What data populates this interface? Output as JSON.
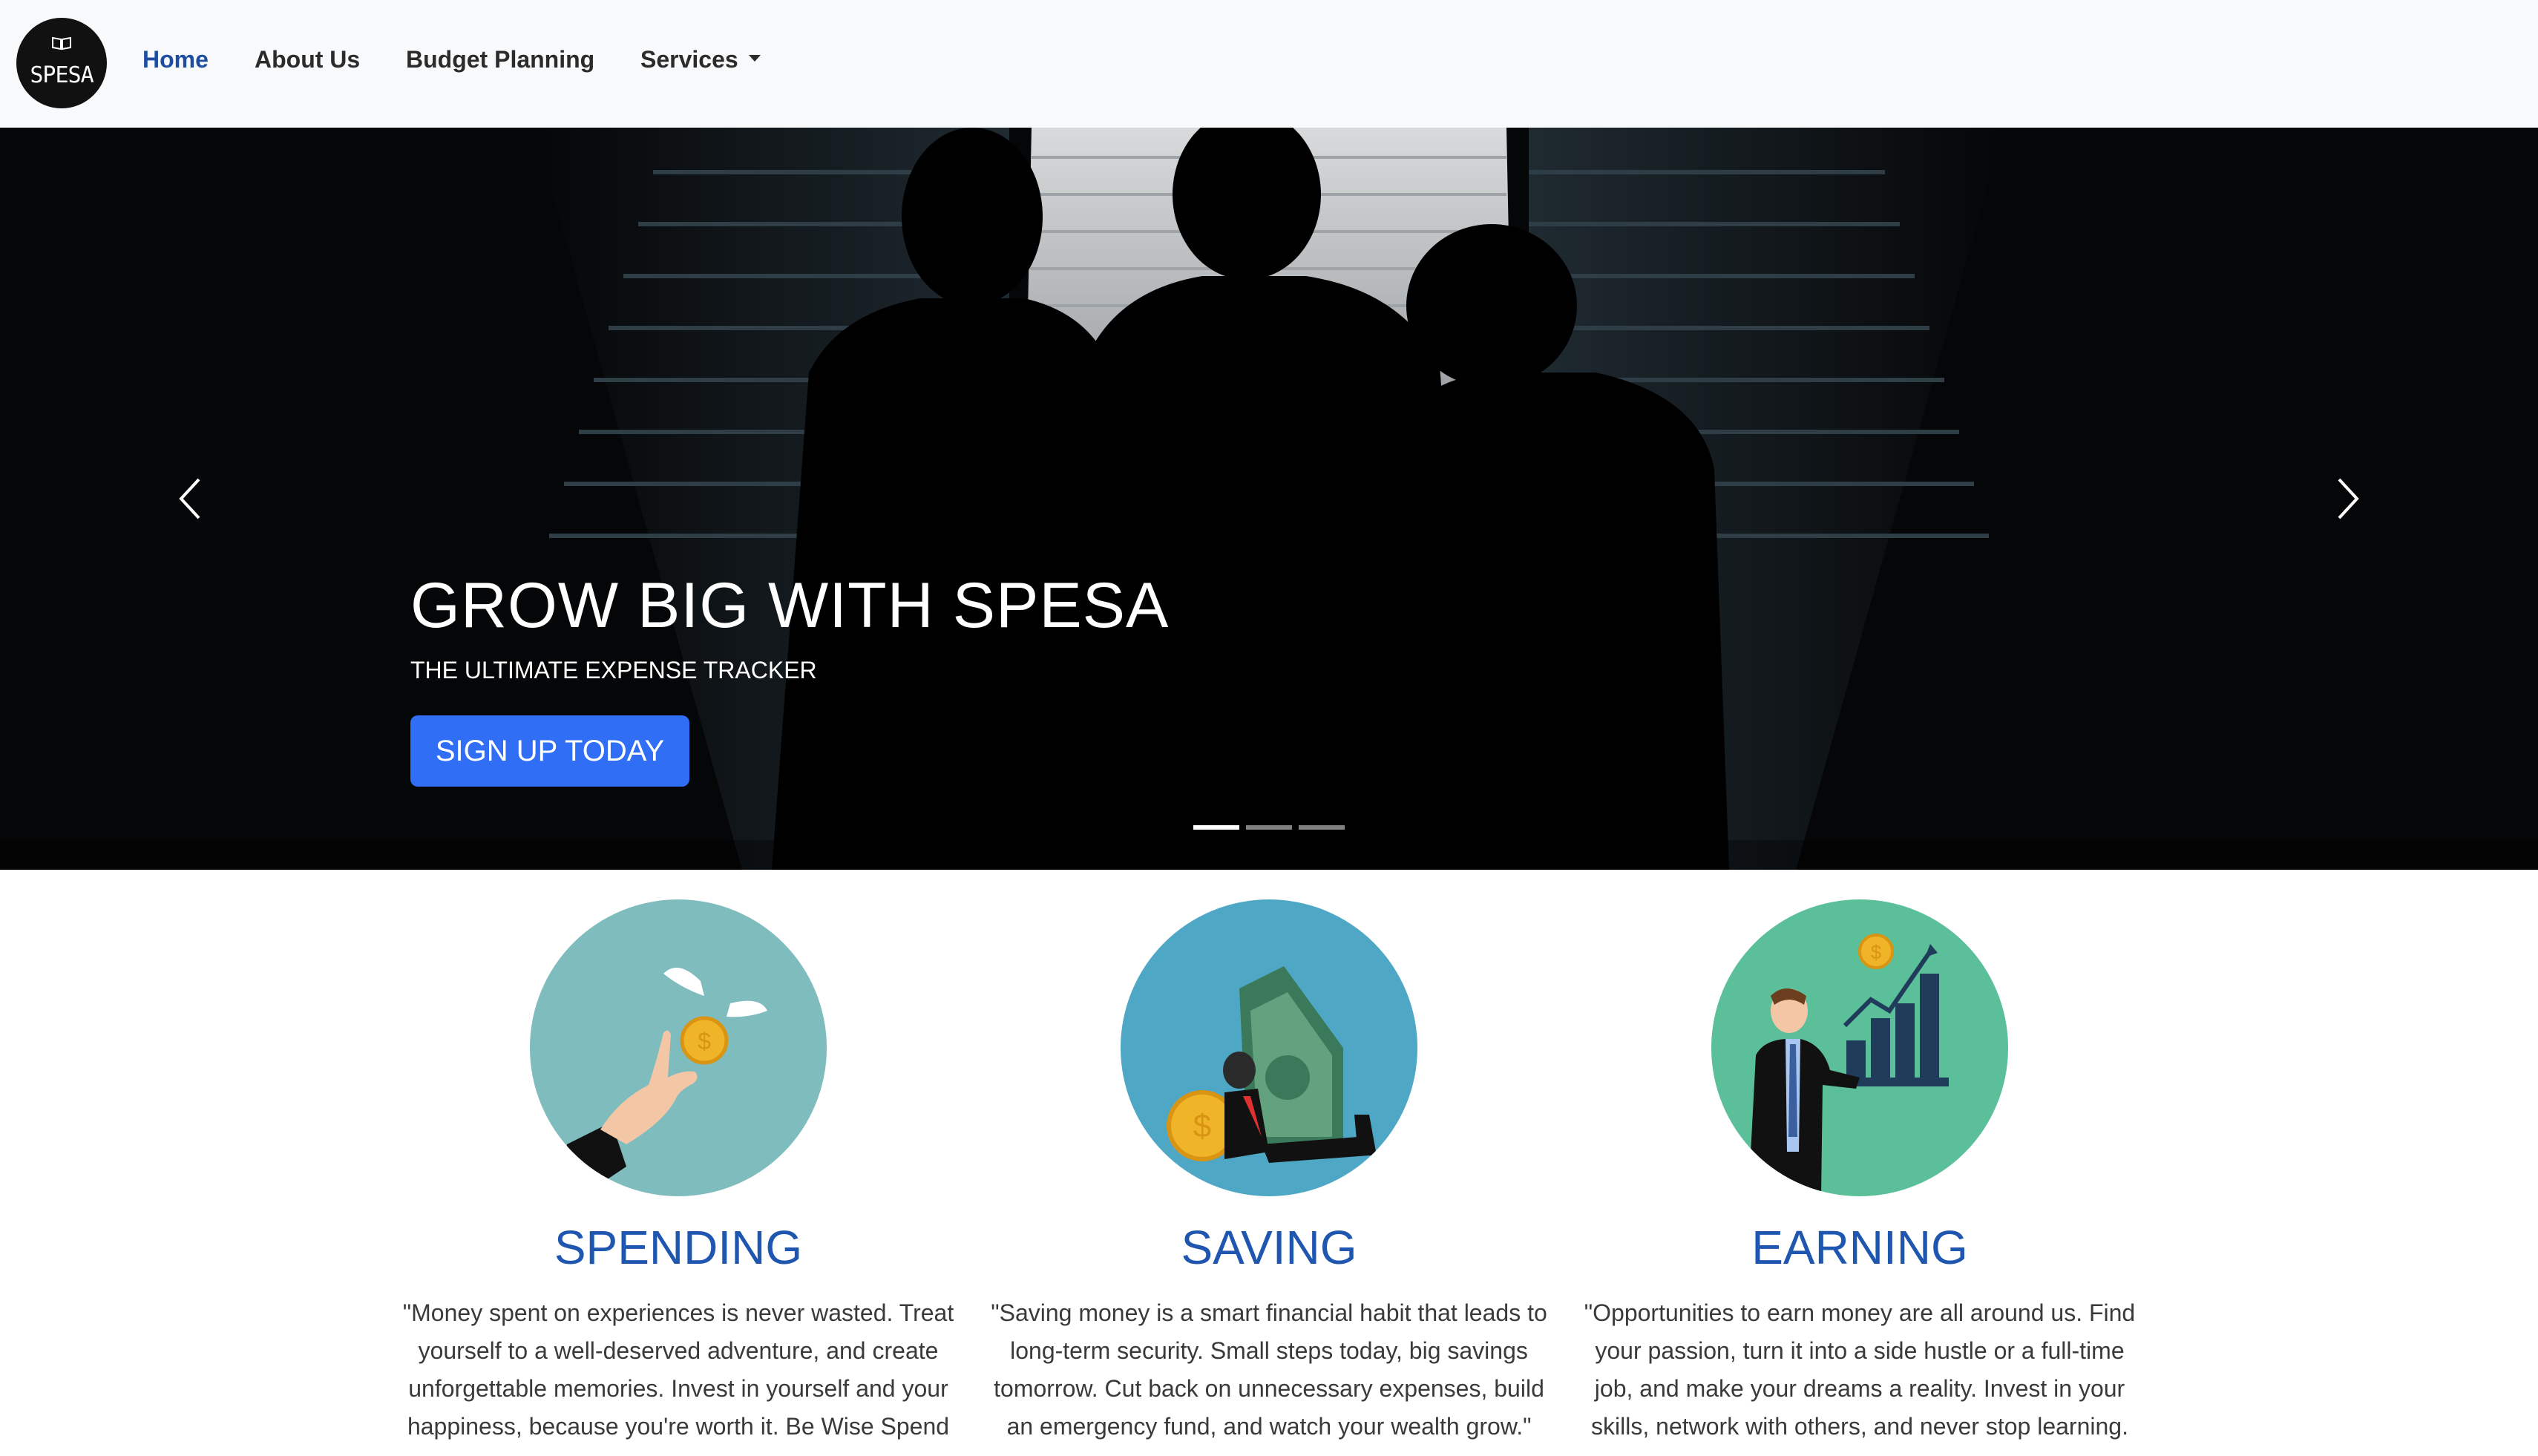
{
  "brand": {
    "logo_text": "SPESA"
  },
  "nav": {
    "home": "Home",
    "about": "About Us",
    "budget": "Budget Planning",
    "services": "Services"
  },
  "hero": {
    "title": "GROW BIG WITH SPESA",
    "subtitle": "THE ULTIMATE EXPENSE TRACKER",
    "cta": "SIGN UP TODAY",
    "active_slide": 1,
    "slide_count": 3
  },
  "features": [
    {
      "title": "SPENDING",
      "text": "\"Money spent on experiences is never wasted. Treat yourself to a well-deserved adventure, and create unforgettable memories. Invest in yourself and your happiness, because you're worth it. Be Wise Spend",
      "circle_color": "#7fbcbd"
    },
    {
      "title": "SAVING",
      "text": "\"Saving money is a smart financial habit that leads to long-term security. Small steps today, big savings tomorrow. Cut back on unnecessary expenses, build an emergency fund, and watch your wealth grow.\"",
      "circle_color": "#4ea8c5"
    },
    {
      "title": "EARNING",
      "text": "\"Opportunities to earn money are all around us. Find your passion, turn it into a side hustle or a full-time job, and make your dreams a reality. Invest in your skills, network with others, and never stop learning.",
      "circle_color": "#5bbf99"
    }
  ],
  "colors": {
    "nav_active": "#1f4ea1",
    "cta": "#2f6ef5",
    "feature_title": "#1f57b0",
    "navbar_bg": "#f8f9fa"
  }
}
